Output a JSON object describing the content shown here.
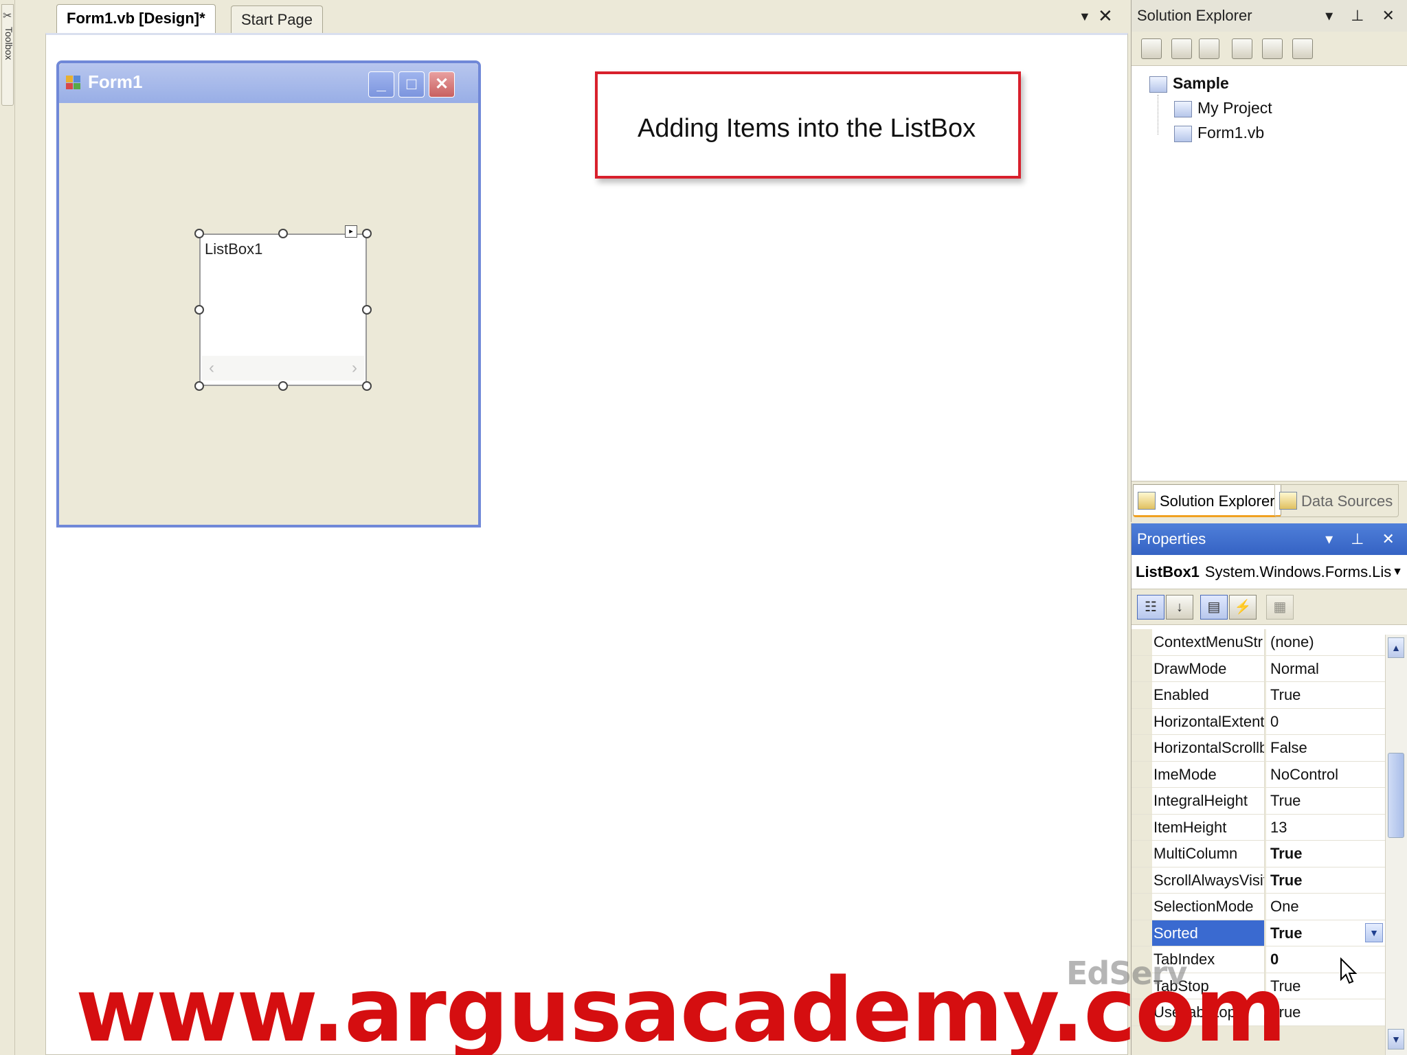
{
  "toolbox": {
    "label": "Toolbox"
  },
  "doc_tabs": {
    "active": "Form1.vb [Design]*",
    "other": "Start Page",
    "menu_glyph": "▼",
    "close_glyph": "✕"
  },
  "form": {
    "title": "Form1",
    "min_glyph": "_",
    "max_glyph": "□",
    "close_glyph": "✕",
    "listbox_label": "ListBox1",
    "scroll_left": "‹",
    "scroll_right": "›"
  },
  "caption": {
    "text": "Adding Items into the ListBox"
  },
  "solution_explorer": {
    "title": "Solution Explorer",
    "header_buttons": "▾ ⊥ ✕",
    "tree": [
      {
        "label": "Sample",
        "bold": true
      },
      {
        "label": "My Project",
        "bold": false
      },
      {
        "label": "Form1.vb",
        "bold": false
      }
    ],
    "tabs": [
      "Solution Explorer",
      "Data Sources"
    ]
  },
  "properties": {
    "title": "Properties",
    "header_buttons": "▾ ⊥ ✕",
    "object_name": "ListBox1",
    "object_type": "System.Windows.Forms.Lis",
    "rows": [
      {
        "name": "ContextMenuStr",
        "value": "(none)",
        "bold": false
      },
      {
        "name": "DrawMode",
        "value": "Normal",
        "bold": false
      },
      {
        "name": "Enabled",
        "value": "True",
        "bold": false
      },
      {
        "name": "HorizontalExtent",
        "value": "0",
        "bold": false
      },
      {
        "name": "HorizontalScrollb",
        "value": "False",
        "bold": false
      },
      {
        "name": "ImeMode",
        "value": "NoControl",
        "bold": false
      },
      {
        "name": "IntegralHeight",
        "value": "True",
        "bold": false
      },
      {
        "name": "ItemHeight",
        "value": "13",
        "bold": false
      },
      {
        "name": "MultiColumn",
        "value": "True",
        "bold": true
      },
      {
        "name": "ScrollAlwaysVisit",
        "value": "True",
        "bold": true
      },
      {
        "name": "SelectionMode",
        "value": "One",
        "bold": false
      },
      {
        "name": "Sorted",
        "value": "True",
        "bold": true,
        "selected": true
      },
      {
        "name": "TabIndex",
        "value": "0",
        "bold": true
      },
      {
        "name": "TabStop",
        "value": "True",
        "bold": false
      },
      {
        "name": "UseTabStops",
        "value": "True",
        "bold": false
      }
    ]
  },
  "watermark": {
    "site": "www.argusacademy.com",
    "edserv": "EdServ"
  },
  "colors": {
    "watermark_red": "#d50e10",
    "caption_border": "#d8202c",
    "selection_blue": "#3a6ad0",
    "properties_header": "#3563c4"
  }
}
